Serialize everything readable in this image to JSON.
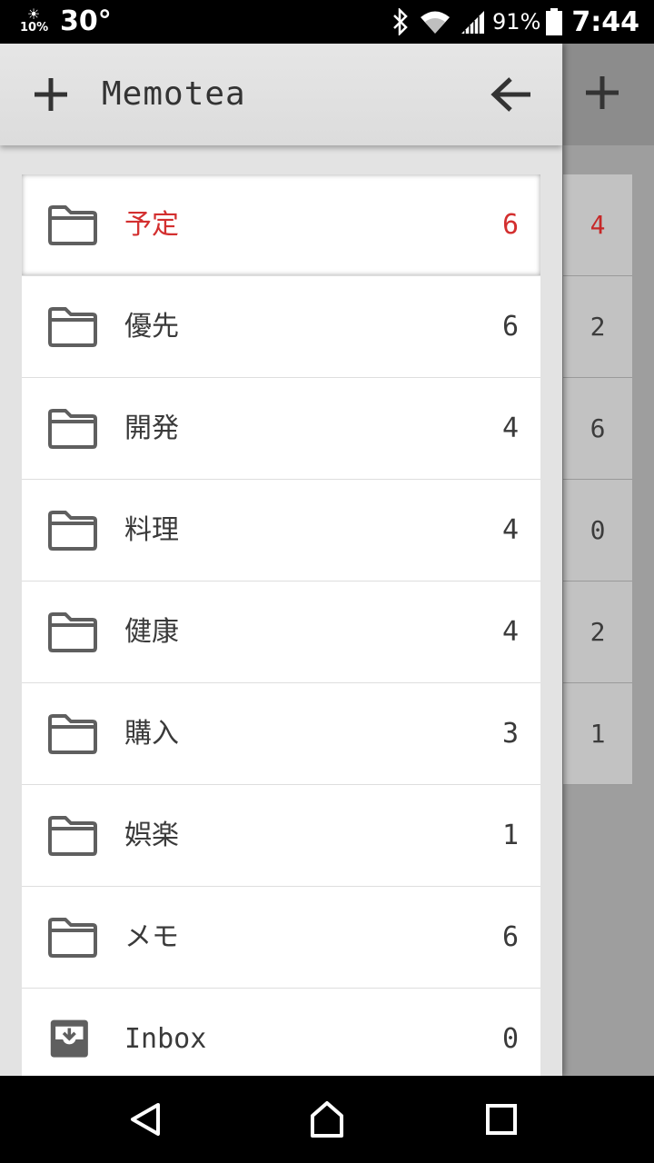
{
  "status_bar": {
    "weather_icon": "sun-icon",
    "weather_percent": "10%",
    "temperature": "30°",
    "icons": [
      "bluetooth-icon",
      "wifi-icon",
      "signal-icon",
      "battery-icon"
    ],
    "battery_percent": "91%",
    "time": "7:44"
  },
  "drawer": {
    "title": "Memotea",
    "add_icon": "plus-icon",
    "back_icon": "arrow-left-icon",
    "folders": [
      {
        "label": "予定",
        "count": "6",
        "icon": "folder-icon",
        "selected": true
      },
      {
        "label": "優先",
        "count": "6",
        "icon": "folder-icon"
      },
      {
        "label": "開発",
        "count": "4",
        "icon": "folder-icon"
      },
      {
        "label": "料理",
        "count": "4",
        "icon": "folder-icon"
      },
      {
        "label": "健康",
        "count": "4",
        "icon": "folder-icon"
      },
      {
        "label": "購入",
        "count": "3",
        "icon": "folder-icon"
      },
      {
        "label": "娯楽",
        "count": "1",
        "icon": "folder-icon"
      },
      {
        "label": "メモ",
        "count": "6",
        "icon": "folder-icon"
      },
      {
        "label": "Inbox",
        "count": "0",
        "icon": "inbox-icon"
      }
    ]
  },
  "background_list": {
    "counts": [
      "4",
      "2",
      "6",
      "0",
      "2",
      "1"
    ]
  },
  "colors": {
    "accent_red": "#d32f2f",
    "drawer_bg": "#e3e3e3",
    "scrim": "#9e9e9e"
  },
  "nav_bar": {
    "buttons": [
      "back-triangle-icon",
      "home-icon",
      "recents-square-icon"
    ]
  }
}
